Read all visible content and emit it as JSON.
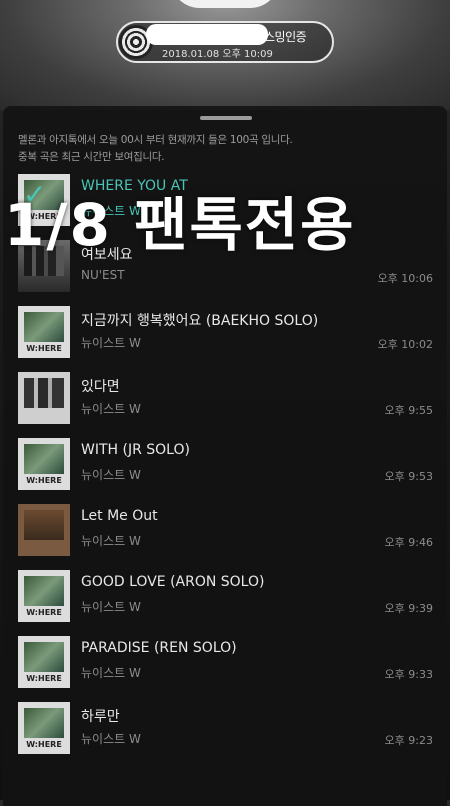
{
  "auth": {
    "label": "스밍인증",
    "datetime": "2018.01.08 오후 10:09"
  },
  "info": {
    "line1": "멜론과 아지톡에서 오늘 00시 부터 현재까지 들은 100곡 입니다.",
    "line2": "중복 곡은 최근 시간만 보여집니다."
  },
  "overlay": "1/8 팬톡전용",
  "songs": [
    {
      "title": "WHERE YOU AT",
      "artist": "뉴이스트 W",
      "time": "",
      "art": "W:HERE",
      "active": true
    },
    {
      "title": "여보세요",
      "artist": "NU'EST",
      "time": "오후 10:06",
      "art": "",
      "active": false
    },
    {
      "title": "지금까지 행복했어요 (BAEKHO SOLO)",
      "artist": "뉴이스트 W",
      "time": "오후 10:02",
      "art": "W:HERE",
      "active": false
    },
    {
      "title": "있다면",
      "artist": "뉴이스트 W",
      "time": "오후 9:55",
      "art": "",
      "active": false
    },
    {
      "title": "WITH (JR SOLO)",
      "artist": "뉴이스트 W",
      "time": "오후 9:53",
      "art": "W:HERE",
      "active": false
    },
    {
      "title": "Let Me Out",
      "artist": "뉴이스트 W",
      "time": "오후 9:46",
      "art": "",
      "active": false
    },
    {
      "title": "GOOD LOVE (ARON SOLO)",
      "artist": "뉴이스트 W",
      "time": "오후 9:39",
      "art": "W:HERE",
      "active": false
    },
    {
      "title": "PARADISE (REN SOLO)",
      "artist": "뉴이스트 W",
      "time": "오후 9:33",
      "art": "W:HERE",
      "active": false
    },
    {
      "title": "하루만",
      "artist": "뉴이스트 W",
      "time": "오후 9:23",
      "art": "W:HERE",
      "active": false
    }
  ],
  "colors": {
    "accent": "#49c5b6"
  }
}
